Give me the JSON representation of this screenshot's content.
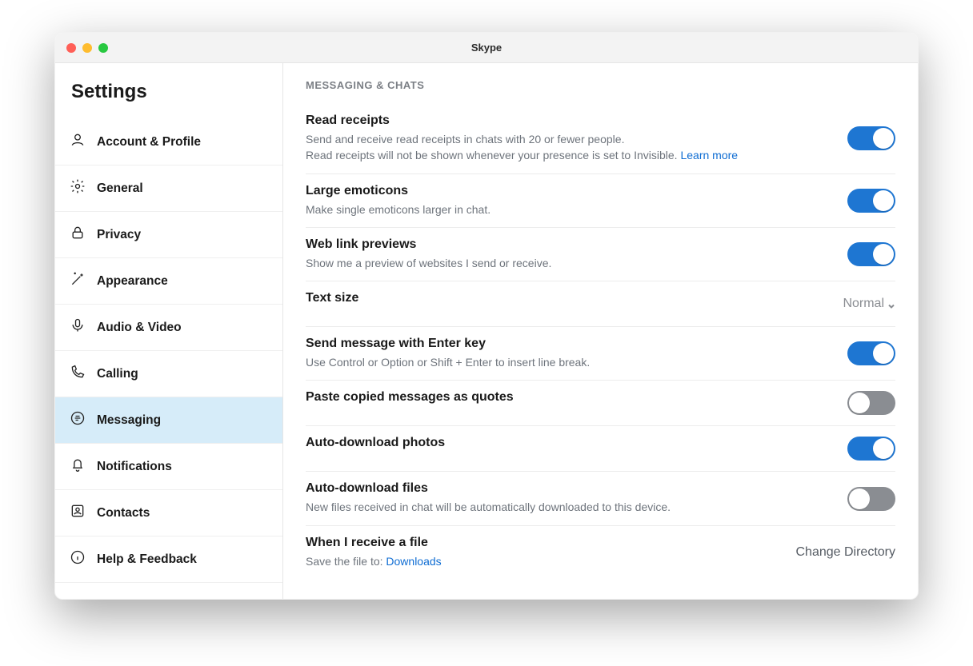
{
  "window": {
    "title": "Skype"
  },
  "sidebar": {
    "heading": "Settings",
    "items": [
      {
        "id": "account",
        "label": "Account & Profile",
        "icon": "user-icon"
      },
      {
        "id": "general",
        "label": "General",
        "icon": "gear-icon"
      },
      {
        "id": "privacy",
        "label": "Privacy",
        "icon": "lock-icon"
      },
      {
        "id": "appearance",
        "label": "Appearance",
        "icon": "wand-icon"
      },
      {
        "id": "audio-video",
        "label": "Audio & Video",
        "icon": "mic-icon"
      },
      {
        "id": "calling",
        "label": "Calling",
        "icon": "phone-icon"
      },
      {
        "id": "messaging",
        "label": "Messaging",
        "icon": "chat-icon",
        "selected": true
      },
      {
        "id": "notifications",
        "label": "Notifications",
        "icon": "bell-icon"
      },
      {
        "id": "contacts",
        "label": "Contacts",
        "icon": "contacts-icon"
      },
      {
        "id": "help",
        "label": "Help & Feedback",
        "icon": "info-icon"
      }
    ]
  },
  "content": {
    "category_title": "MESSAGING & CHATS",
    "settings": [
      {
        "id": "read-receipts",
        "label": "Read receipts",
        "desc": "Send and receive read receipts in chats with 20 or fewer people.",
        "desc2": "Read receipts will not be shown whenever your presence is set to Invisible. ",
        "link": "Learn more",
        "control": {
          "type": "toggle",
          "value": true
        }
      },
      {
        "id": "large-emoticons",
        "label": "Large emoticons",
        "desc": "Make single emoticons larger in chat.",
        "control": {
          "type": "toggle",
          "value": true
        }
      },
      {
        "id": "web-link-previews",
        "label": "Web link previews",
        "desc": "Show me a preview of websites I send or receive.",
        "control": {
          "type": "toggle",
          "value": true
        }
      },
      {
        "id": "text-size",
        "label": "Text size",
        "control": {
          "type": "select",
          "value": "Normal"
        }
      },
      {
        "id": "send-enter",
        "label": "Send message with Enter key",
        "desc": "Use Control or Option or Shift + Enter to insert line break.",
        "control": {
          "type": "toggle",
          "value": true
        }
      },
      {
        "id": "paste-quotes",
        "label": "Paste copied messages as quotes",
        "control": {
          "type": "toggle",
          "value": false
        }
      },
      {
        "id": "auto-download-photos",
        "label": "Auto-download photos",
        "control": {
          "type": "toggle",
          "value": true
        }
      },
      {
        "id": "auto-download-files",
        "label": "Auto-download files",
        "desc": "New files received in chat will be automatically downloaded to this device.",
        "control": {
          "type": "toggle",
          "value": false
        }
      },
      {
        "id": "receive-file",
        "label": "When I receive a file",
        "desc_prefix": "Save the file to: ",
        "desc_link": "Downloads",
        "control": {
          "type": "action",
          "value": "Change Directory"
        }
      }
    ]
  },
  "colors": {
    "accent": "#1e76d2",
    "muted": "#8a8d92",
    "selected": "#d6ecf9",
    "link": "#0f6dd3"
  }
}
